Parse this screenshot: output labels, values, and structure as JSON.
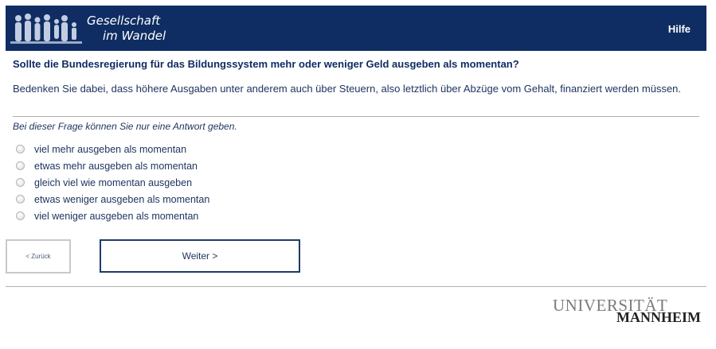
{
  "header": {
    "logo_line1": "Gesellschaft",
    "logo_line2": "im Wandel",
    "help_label": "Hilfe",
    "background_color": "#0f2d63"
  },
  "question": {
    "title": "Sollte die Bundesregierung für das Bildungssystem mehr oder weniger Geld ausgeben als momentan?",
    "hint": "Bedenken Sie dabei, dass höhere Ausgaben unter anderem auch über Steuern, also letztlich über Abzüge vom Gehalt, finanziert werden müssen.",
    "instruction": "Bei dieser Frage können Sie nur eine Antwort geben.",
    "options": [
      "viel mehr ausgeben als momentan",
      "etwas mehr ausgeben als momentan",
      "gleich viel wie momentan ausgeben",
      "etwas weniger ausgeben als momentan",
      "viel weniger ausgeben als momentan"
    ]
  },
  "navigation": {
    "back_label": "< Zurück",
    "next_label": "Weiter >"
  },
  "footer": {
    "logo_line1": "UNIVERSITÄT",
    "logo_line2": "MANNHEIM"
  }
}
